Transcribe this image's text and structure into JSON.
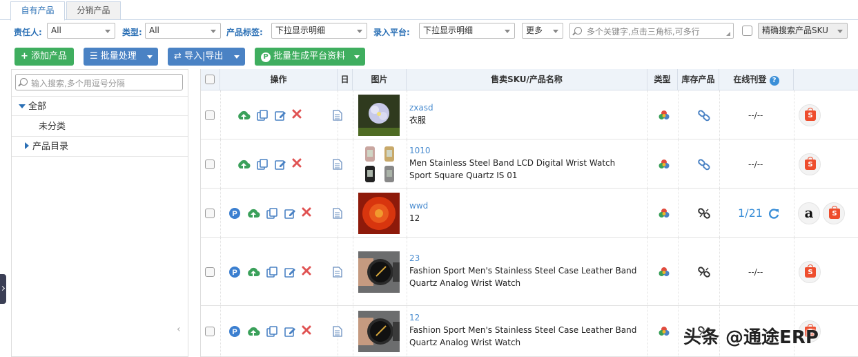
{
  "tabs": [
    {
      "label": "自有产品"
    },
    {
      "label": "分销产品"
    }
  ],
  "filters": {
    "owner_label": "责任人:",
    "owner_value": "All",
    "type_label": "类型:",
    "type_value": "All",
    "tag_label": "产品标签:",
    "tag_value": "下拉显示明细",
    "platform_label": "录入平台:",
    "platform_value": "下拉显示明细",
    "more_value": "更多",
    "keyword_placeholder": "多个关键字,点击三角标,可多行",
    "exact_sku_value": "精确搜索产品SKU"
  },
  "toolbar": {
    "add_label": "添加产品",
    "batch_label": "批量处理",
    "import_label": "导入|导出",
    "generate_label": "批量生成平台资料"
  },
  "sidebar": {
    "search_placeholder": "输入搜索,多个用逗号分隔",
    "items": [
      {
        "label": "全部"
      },
      {
        "label": "未分类"
      },
      {
        "label": "产品目录"
      }
    ]
  },
  "table": {
    "headers": {
      "op": "操作",
      "log": "日志",
      "img": "图片",
      "name": "售卖SKU/产品名称",
      "type": "类型",
      "stock": "库存产品",
      "online": "在线刊登"
    },
    "rows": [
      {
        "sku": "zxasd",
        "name": "衣服",
        "online": "--/--",
        "thumb": "flower"
      },
      {
        "sku": "1010",
        "name": "Men Stainless Steel Band LCD Digital Wrist Watch Sport Square Quartz IS 01",
        "online": "--/--",
        "thumb": "watches"
      },
      {
        "sku": "wwd",
        "name": "12",
        "online": "1/21",
        "thumb": "redflower"
      },
      {
        "sku": "23",
        "name": "Fashion Sport Men's Stainless Steel Case Leather Band Quartz Analog Wrist Watch",
        "online": "--/--",
        "thumb": "wristwatch"
      },
      {
        "sku": "12",
        "name": "Fashion Sport Men's Stainless Steel Case Leather Band Quartz Analog Wrist Watch",
        "online": "",
        "thumb": "wristwatch"
      }
    ]
  },
  "watermark": "头条 @通途ERP",
  "colors": {
    "accent": "#2a6fb5",
    "green_button": "#3fae5f",
    "blue_button": "#4a82c4",
    "shopee": "#ee4d2d",
    "delete_red": "#e05353"
  }
}
